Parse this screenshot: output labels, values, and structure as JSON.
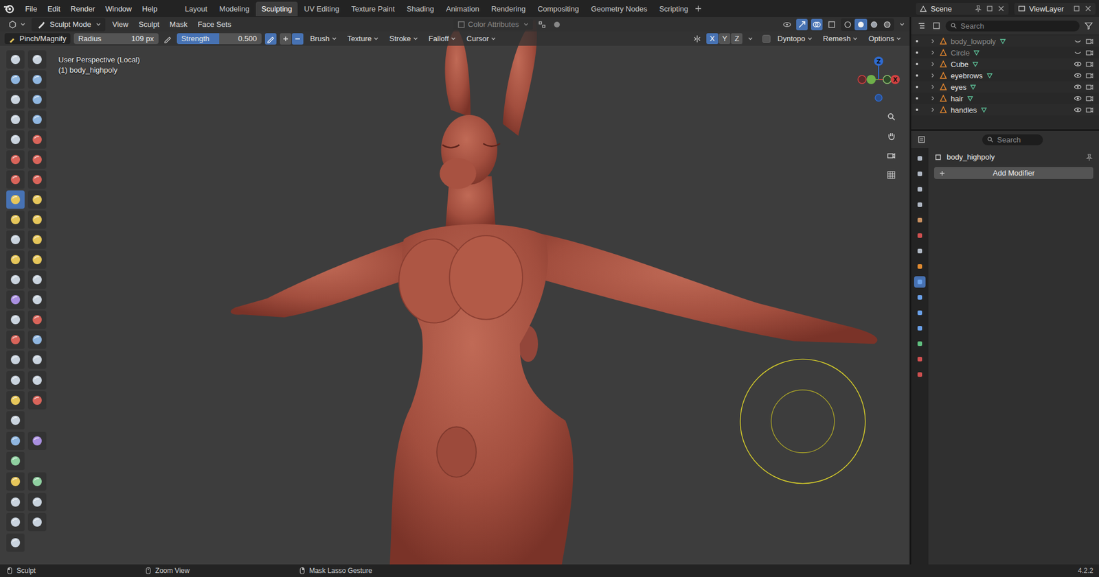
{
  "app": {
    "menus": [
      "File",
      "Edit",
      "Render",
      "Window",
      "Help"
    ],
    "workspaces": [
      {
        "label": "Layout",
        "selected": false
      },
      {
        "label": "Modeling",
        "selected": false
      },
      {
        "label": "Sculpting",
        "selected": true
      },
      {
        "label": "UV Editing",
        "selected": false
      },
      {
        "label": "Texture Paint",
        "selected": false
      },
      {
        "label": "Shading",
        "selected": false
      },
      {
        "label": "Animation",
        "selected": false
      },
      {
        "label": "Rendering",
        "selected": false
      },
      {
        "label": "Compositing",
        "selected": false
      },
      {
        "label": "Geometry Nodes",
        "selected": false
      },
      {
        "label": "Scripting",
        "selected": false
      }
    ],
    "scene": "Scene",
    "view_layer": "ViewLayer"
  },
  "viewport": {
    "mode": "Sculpt Mode",
    "menus": [
      "View",
      "Sculpt",
      "Mask",
      "Face Sets"
    ],
    "color_attributes": {
      "label": "Color Attributes",
      "disabled": true
    },
    "shading": [
      {
        "kind": "wireframe",
        "selected": false
      },
      {
        "kind": "solid",
        "selected": true
      },
      {
        "kind": "material",
        "selected": false
      },
      {
        "kind": "rendered",
        "selected": false
      }
    ],
    "view_name": "User Perspective (Local)",
    "object_label": "(1) body_highpoly"
  },
  "tool_settings": {
    "brush": "Pinch/Magnify",
    "radius_label": "Radius",
    "radius": "109 px",
    "strength_label": "Strength",
    "strength": "0.500",
    "strength_level": 0.5,
    "menus": [
      "Brush",
      "Texture",
      "Stroke",
      "Falloff",
      "Cursor"
    ],
    "symmetry": [
      {
        "axis": "X",
        "selected": true
      },
      {
        "axis": "Y",
        "selected": false
      },
      {
        "axis": "Z",
        "selected": false
      }
    ],
    "dyntopo": {
      "label": "Dyntopo",
      "checked": false
    },
    "right_menus": [
      "Remesh",
      "Options"
    ]
  },
  "toolbar": [
    [
      {
        "color": "#c9d3de",
        "selected": false
      },
      {
        "color": "#c9d3de",
        "selected": false
      },
      {
        "color": "#8fb6e0",
        "selected": false
      },
      {
        "color": "#8fb6e0",
        "selected": false
      },
      {
        "color": "#c9d3de",
        "selected": false
      },
      {
        "color": "#8fb6e0",
        "selected": false
      },
      {
        "color": "#c9d3de",
        "selected": false
      },
      {
        "color": "#8fb6e0",
        "selected": false
      },
      {
        "color": "#c9d3de",
        "selected": false
      },
      {
        "color": "#d9645a",
        "selected": false
      },
      {
        "color": "#d9645a",
        "selected": false
      },
      {
        "color": "#d9645a",
        "selected": false
      },
      {
        "color": "#d9645a",
        "selected": false
      },
      {
        "color": "#d9645a",
        "selected": false
      },
      {
        "color": "#e6c65a",
        "selected": true
      },
      {
        "color": "#e6c65a",
        "selected": false
      },
      {
        "color": "#e6c65a",
        "selected": false
      },
      {
        "color": "#e6c65a",
        "selected": false
      },
      {
        "color": "#c9d3de",
        "selected": false
      },
      {
        "color": "#e6c65a",
        "selected": false
      },
      {
        "color": "#e6c65a",
        "selected": false
      },
      {
        "color": "#e6c65a",
        "selected": false
      },
      {
        "color": "#c9d3de",
        "selected": false
      },
      {
        "color": "#c9d3de",
        "selected": false
      },
      {
        "color": "#a98fe0",
        "selected": false
      },
      {
        "color": "#c9d3de",
        "selected": false
      },
      {
        "color": "#c9d3de",
        "selected": false
      },
      {
        "color": "#d9645a",
        "selected": false
      },
      {
        "color": "#d9645a",
        "selected": false
      },
      {
        "color": "#8fb6e0",
        "selected": false
      },
      {
        "color": "#c9d3de",
        "selected": false
      },
      {
        "color": "#c9d3de",
        "selected": false
      }
    ],
    [
      {
        "color": "#c9d3de",
        "selected": false
      },
      {
        "color": "#c9d3de",
        "selected": false
      },
      {
        "color": "#e6c65a",
        "selected": false
      },
      {
        "color": "#d9645a",
        "selected": false
      },
      {
        "color": "#c9d3de",
        "selected": false
      }
    ],
    [
      {
        "color": "#8fb6e0",
        "selected": false
      },
      {
        "color": "#a98fe0",
        "selected": false
      },
      {
        "color": "#8fd0a0",
        "selected": false
      }
    ],
    [
      {
        "color": "#e6c65a",
        "selected": false
      },
      {
        "color": "#8fd0a0",
        "selected": false
      }
    ],
    [
      {
        "color": "#c9d3de",
        "selected": false
      },
      {
        "color": "#c9d3de",
        "selected": false
      },
      {
        "color": "#c9d3de",
        "selected": false
      },
      {
        "color": "#c9d3de",
        "selected": false
      }
    ],
    [
      {
        "color": "#c9d3de",
        "selected": false
      }
    ]
  ],
  "gizmo": {
    "z": "Z",
    "x": "X"
  },
  "outliner": {
    "search_placeholder": "Search",
    "items": [
      {
        "name": "body_lowpoly",
        "hidden": true
      },
      {
        "name": "Circle",
        "hidden": true
      },
      {
        "name": "Cube",
        "hidden": false
      },
      {
        "name": "eyebrows",
        "hidden": false
      },
      {
        "name": "eyes",
        "hidden": false
      },
      {
        "name": "hair",
        "hidden": false
      },
      {
        "name": "handles",
        "hidden": false
      }
    ]
  },
  "properties": {
    "search_placeholder": "Search",
    "object": "body_highpoly",
    "add_modifier": "Add Modifier",
    "tabs": [
      {
        "color": "#b0b8c4",
        "selected": false
      },
      {
        "color": "#b0b8c4",
        "selected": false
      },
      {
        "color": "#b0b8c4",
        "selected": false
      },
      {
        "color": "#b0b8c4",
        "selected": false
      },
      {
        "color": "#c99060",
        "selected": false
      },
      {
        "color": "#d05050",
        "selected": false
      },
      {
        "color": "#b0b8c4",
        "selected": false
      },
      {
        "color": "#e08a30",
        "selected": false
      },
      {
        "color": "#6aa0e8",
        "selected": true
      },
      {
        "color": "#6aa0e8",
        "selected": false
      },
      {
        "color": "#6aa0e8",
        "selected": false
      },
      {
        "color": "#6aa0e8",
        "selected": false
      },
      {
        "color": "#60c080",
        "selected": false
      },
      {
        "color": "#d05050",
        "selected": false
      },
      {
        "color": "#d05050",
        "selected": false
      }
    ]
  },
  "status_bar": {
    "items": [
      "Sculpt",
      "Zoom View",
      "Mask Lasso Gesture"
    ],
    "version": "4.2.2"
  }
}
